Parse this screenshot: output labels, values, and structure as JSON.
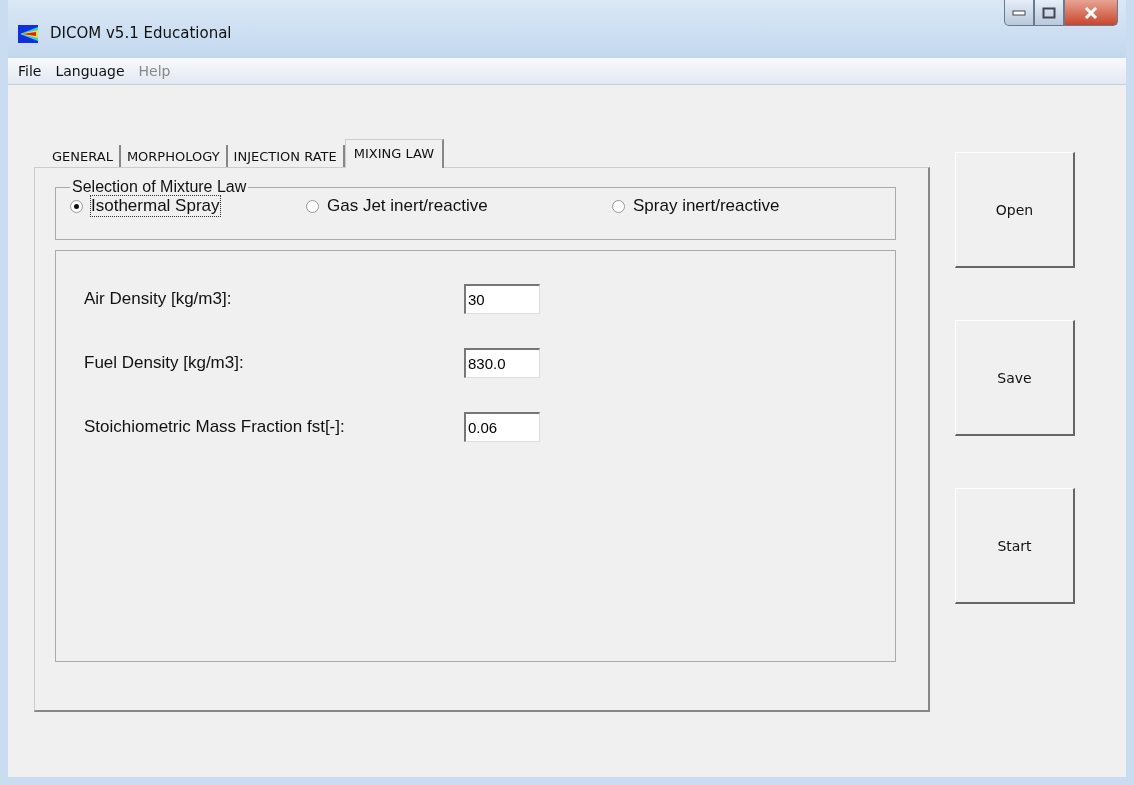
{
  "window": {
    "title": "DICOM v5.1 Educational"
  },
  "menu": [
    {
      "label": "File",
      "disabled": false
    },
    {
      "label": "Language",
      "disabled": false
    },
    {
      "label": "Help",
      "disabled": true
    }
  ],
  "tabs": [
    {
      "label": "GENERAL",
      "selected": false
    },
    {
      "label": "MORPHOLOGY",
      "selected": false
    },
    {
      "label": "INJECTION RATE",
      "selected": false
    },
    {
      "label": "MIXING LAW",
      "selected": true
    }
  ],
  "mixture_group": {
    "title": "Selection of Mixture Law",
    "options": [
      {
        "label": "Isothermal Spray",
        "selected": true
      },
      {
        "label": "Gas Jet inert/reactive",
        "selected": false
      },
      {
        "label": "Spray inert/reactive",
        "selected": false
      }
    ]
  },
  "fields": [
    {
      "label": "Air Density [kg/m3]:",
      "value": "30"
    },
    {
      "label": "Fuel Density [kg/m3]:",
      "value": "830.0"
    },
    {
      "label": "Stoichiometric Mass Fraction fst[-]:",
      "value": "0.06"
    }
  ],
  "buttons": [
    "Open",
    "Save",
    "Start"
  ]
}
